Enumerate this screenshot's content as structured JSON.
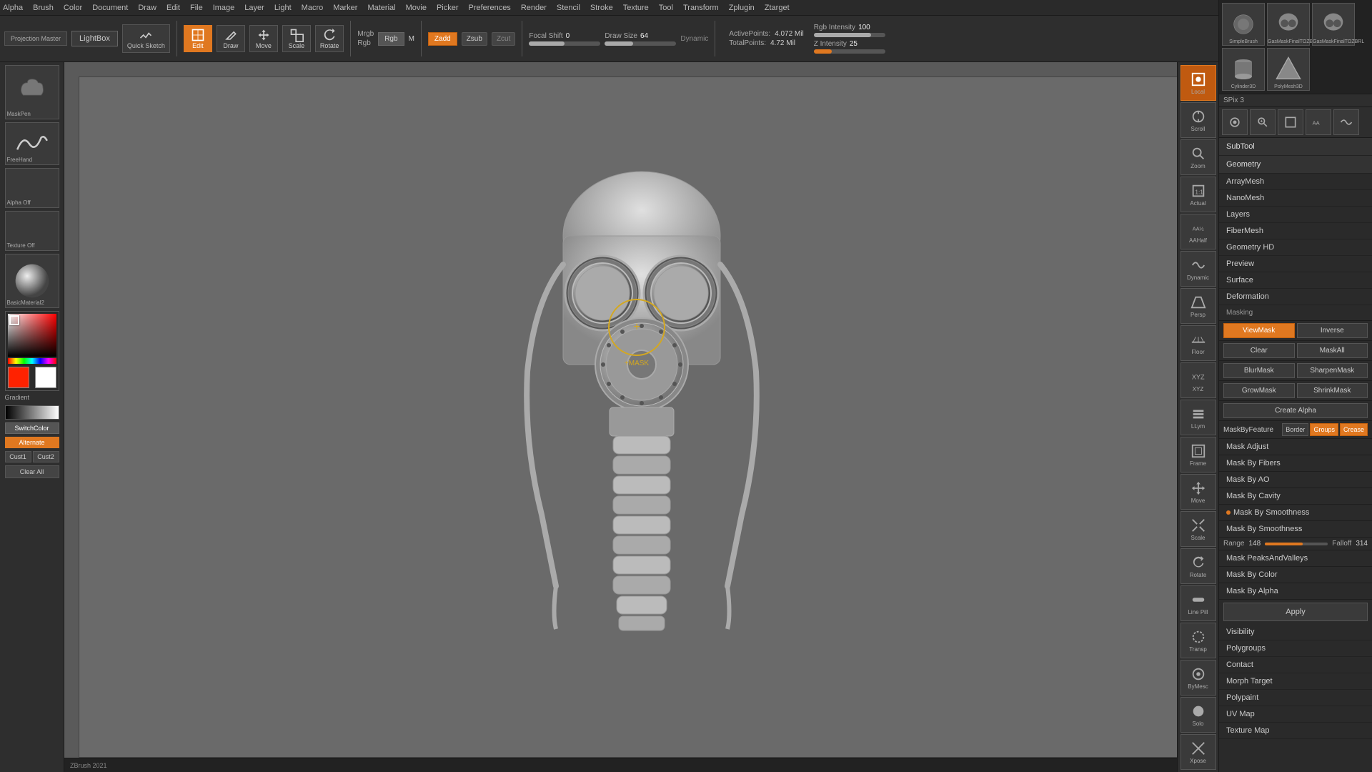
{
  "app": {
    "title": "ZBrush"
  },
  "top_menu": {
    "items": [
      "Alpha",
      "Brush",
      "Color",
      "Document",
      "Draw",
      "Edit",
      "File",
      "Image",
      "Layer",
      "Light",
      "Macro",
      "Marker",
      "Material",
      "Movie",
      "Picker",
      "Preferences",
      "Render",
      "Stencil",
      "Stroke",
      "Texture",
      "Tool",
      "Transform",
      "Zplugin",
      "Ztarget"
    ]
  },
  "toolbar": {
    "projection_master": "Projection\nMaster",
    "lightbox": "LightBox",
    "quick_sketch": "Quick\nSketch",
    "edit_btn": "Edit",
    "draw_btn": "Draw",
    "move_btn": "Move",
    "scale_btn": "Scale",
    "rotate_btn": "Rotate",
    "mrgb_label": "Mrgb",
    "rgb_label": "Rgb",
    "m_label": "M",
    "zadd_label": "Zadd",
    "zsub_label": "Zsub",
    "zcut_label": "Zcut",
    "focal_shift": "Focal Shift",
    "focal_shift_val": "0",
    "draw_size": "Draw Size",
    "draw_size_val": "64",
    "dynamic_label": "Dynamic",
    "active_points": "ActivePoints:",
    "active_points_val": "4.072 Mil",
    "total_points": "TotalPoints:",
    "total_points_val": "4.72 Mil",
    "rgb_intensity_label": "Rgb Intensity",
    "rgb_intensity_val": "100",
    "z_intensity_label": "Z Intensity",
    "z_intensity_val": "25"
  },
  "left_panel": {
    "brush_label": "MaskPen",
    "brush2_label": "FreeHand",
    "alpha_label": "Alpha Off",
    "texture_label": "Texture Off",
    "material_label": "BasicMaterial2",
    "gradient_label": "Gradient",
    "switch_color_label": "SwitchColor",
    "alternate_label": "Alternate",
    "cust1_label": "Cust1",
    "cust2_label": "Cust2",
    "clear_all_label": "Clear All"
  },
  "cursor": {
    "label": "+MASK"
  },
  "right_icons": {
    "items": [
      {
        "icon": "brush",
        "label": "SPixl 3"
      },
      {
        "icon": "scroll",
        "label": "Scroll"
      },
      {
        "icon": "zoom",
        "label": "Zoom"
      },
      {
        "icon": "actual",
        "label": "Actual"
      },
      {
        "icon": "aaHalf",
        "label": "AAHalf"
      },
      {
        "icon": "dynamic",
        "label": "Dynamic"
      },
      {
        "icon": "persp",
        "label": "Persp"
      },
      {
        "icon": "floor",
        "label": "Floor"
      },
      {
        "icon": "local",
        "label": "Local"
      },
      {
        "icon": "xyz",
        "label": "XYZ"
      },
      {
        "icon": "layers",
        "label": "LLym"
      },
      {
        "icon": "frame",
        "label": "Frame"
      },
      {
        "icon": "move",
        "label": "Move"
      },
      {
        "icon": "scale",
        "label": "Scale"
      },
      {
        "icon": "rotate",
        "label": "Rotate"
      },
      {
        "icon": "linePhil",
        "label": "Line Pill"
      },
      {
        "icon": "transp",
        "label": "Transp"
      },
      {
        "icon": "byMesc",
        "label": "ByMesc"
      },
      {
        "icon": "solo",
        "label": "Solo"
      },
      {
        "icon": "xpose",
        "label": "Xpose"
      }
    ]
  },
  "right_panel": {
    "thumbnails": [
      {
        "label": "SimpleBrush"
      },
      {
        "label": "GasMaskFinalTOZBRL"
      },
      {
        "label": "GasMaskFinalTOZBRL"
      },
      {
        "label": "Cylinder3D"
      },
      {
        "label": "PolyMesh3D"
      }
    ],
    "spix": "SPix 3",
    "sections": [
      {
        "label": "SubTool"
      },
      {
        "label": "Geometry",
        "active": true
      },
      {
        "label": "ArrayMesh"
      },
      {
        "label": "NanoMesh"
      },
      {
        "label": "Layers"
      },
      {
        "label": "FiberMesh"
      },
      {
        "label": "Geometry HD"
      },
      {
        "label": "Preview"
      },
      {
        "label": "Surface"
      },
      {
        "label": "Deformation"
      }
    ],
    "masking": {
      "header": "Masking",
      "viewmask_label": "ViewMask",
      "inverse_label": "Inverse",
      "clear_label": "Clear",
      "maskall_label": "MaskAll",
      "blurmask_label": "BlurMask",
      "sharpenmask_label": "SharpenMask",
      "growmask_label": "GrowMask",
      "shrinkmask_label": "ShrinkMask",
      "create_alpha_label": "Create Alpha",
      "maskbyfeature_label": "MaskByFeature",
      "border_label": "Border",
      "groups_label": "Groups",
      "crease_label": "Crease",
      "mask_adjust_label": "Mask Adjust",
      "mask_by_fibers_label": "Mask By Fibers",
      "mask_by_ao_label": "Mask By AO",
      "mask_by_cavity_label": "Mask By Cavity",
      "mask_by_smoothness_label": "Mask By Smoothness",
      "range_label": "Range",
      "range_val": "148",
      "falloff_label": "Falloff",
      "falloff_val": "314",
      "mask_peaks_label": "Mask PeaksAndValleys",
      "mask_by_color_label": "Mask By Color",
      "mask_by_alpha_label": "Mask By Alpha",
      "apply_label": "Apply"
    },
    "bottom_sections": [
      {
        "label": "Visibility"
      },
      {
        "label": "Polygroups"
      },
      {
        "label": "Contact"
      },
      {
        "label": "Morph Target"
      },
      {
        "label": "Polypaint"
      },
      {
        "label": "UV Map"
      },
      {
        "label": "Texture Map"
      }
    ]
  },
  "colors": {
    "orange": "#e07820",
    "bg_dark": "#2a2a2a",
    "bg_medium": "#3a3a3a",
    "accent_yellow": "#d4a820"
  }
}
